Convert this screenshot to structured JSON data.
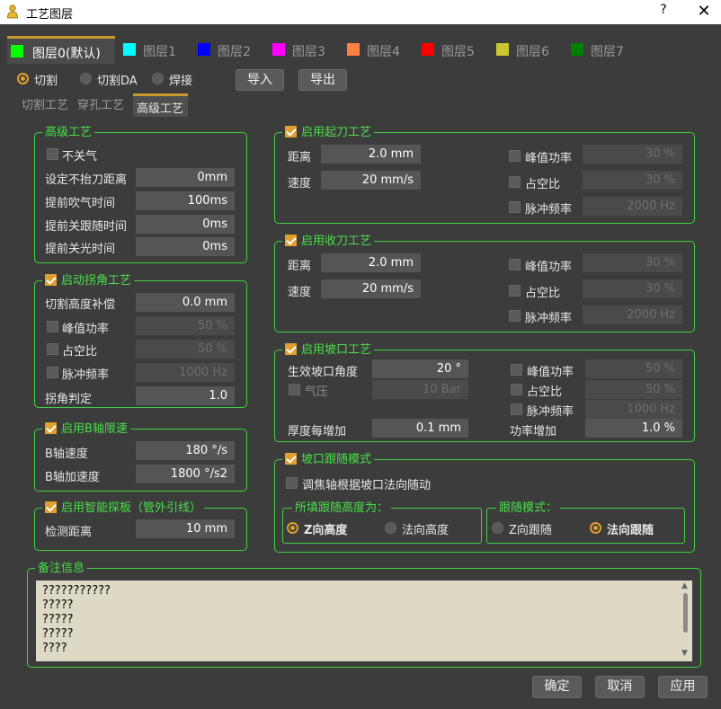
{
  "window": {
    "title": "工艺图层",
    "help": "?",
    "close": "✕"
  },
  "layers": [
    {
      "label": "图层0(默认)",
      "color": "#00ff00"
    },
    {
      "label": "图层1",
      "color": "#00ffff"
    },
    {
      "label": "图层2",
      "color": "#0000ff"
    },
    {
      "label": "图层3",
      "color": "#ff00ff"
    },
    {
      "label": "图层4",
      "color": "#ff8040"
    },
    {
      "label": "图层5",
      "color": "#ff0000"
    },
    {
      "label": "图层6",
      "color": "#c8c830"
    },
    {
      "label": "图层7",
      "color": "#008000"
    }
  ],
  "modes": {
    "cut": "切割",
    "cut_da": "切割DA",
    "weld": "焊接",
    "selected": "切割"
  },
  "io": {
    "import": "导入",
    "export": "导出"
  },
  "subtabs": {
    "cut_process": "切割工艺",
    "pierce_process": "穿孔工艺",
    "advanced_process": "高级工艺"
  },
  "advanced": {
    "title": "高级工艺",
    "no_gas_off": "不关气",
    "no_lift_dist_label": "设定不抬刀距离",
    "no_lift_dist": "0mm",
    "pre_blow_label": "提前吹气时间",
    "pre_blow": "100ms",
    "pre_follow_off_label": "提前关跟随时间",
    "pre_follow_off": "0ms",
    "pre_light_off_label": "提前关光时间",
    "pre_light_off": "0ms"
  },
  "corner": {
    "title": "启动拐角工艺",
    "height_comp_label": "切割高度补偿",
    "height_comp": "0.0 mm",
    "peak_power_label": "峰值功率",
    "peak_power": "50 %",
    "duty_label": "占空比",
    "duty": "50 %",
    "pulse_freq_label": "脉冲频率",
    "pulse_freq": "1000 Hz",
    "judge_label": "拐角判定",
    "judge": "1.0"
  },
  "baxis": {
    "title": "启用B轴限速",
    "speed_label": "B轴速度",
    "speed": "180 °/s",
    "accel_label": "B轴加速度",
    "accel": "1800 °/s2"
  },
  "probe": {
    "title": "启用智能探板（管外引线）",
    "dist_label": "检测距离",
    "dist": "10 mm"
  },
  "start_cut": {
    "title": "启用起刀工艺",
    "dist_label": "距离",
    "dist": "2.0 mm",
    "speed_label": "速度",
    "speed": "20 mm/s",
    "peak_power_label": "峰值功率",
    "peak_power": "30 %",
    "duty_label": "占空比",
    "duty": "30 %",
    "pulse_freq_label": "脉冲频率",
    "pulse_freq": "2000 Hz"
  },
  "end_cut": {
    "title": "启用收刀工艺",
    "dist_label": "距离",
    "dist": "2.0 mm",
    "speed_label": "速度",
    "speed": "20 mm/s",
    "peak_power_label": "峰值功率",
    "peak_power": "30 %",
    "duty_label": "占空比",
    "duty": "30 %",
    "pulse_freq_label": "脉冲频率",
    "pulse_freq": "2000 Hz"
  },
  "bevel": {
    "title": "启用坡口工艺",
    "angle_label": "生效坡口角度",
    "angle": "20 °",
    "gas_label": "气压",
    "gas": "10 Bar",
    "thickness_label": "厚度每增加",
    "thickness": "0.1 mm",
    "power_inc_label": "功率增加",
    "power_inc": "1.0 %",
    "peak_power_label": "峰值功率",
    "peak_power": "50 %",
    "duty_label": "占空比",
    "duty": "50 %",
    "pulse_freq_label": "脉冲频率",
    "pulse_freq": "1000 Hz"
  },
  "bevel_follow": {
    "title": "坡口跟随模式",
    "focus_label": "调焦轴根据坡口法向随动",
    "height_group": "所填跟随高度为：",
    "z_height": "Z向高度",
    "normal_height": "法向高度",
    "mode_group": "跟随模式：",
    "z_follow": "Z向跟随",
    "normal_follow": "法向跟随"
  },
  "notes": {
    "title": "备注信息",
    "lines": [
      "???????????",
      " ?????",
      " ?????",
      " ?????",
      " ????"
    ]
  },
  "footer": {
    "ok": "确定",
    "cancel": "取消",
    "apply": "应用"
  },
  "colors": {
    "accent": "#e0a030",
    "group_border": "#3ed23e",
    "group_title": "#48e048"
  }
}
